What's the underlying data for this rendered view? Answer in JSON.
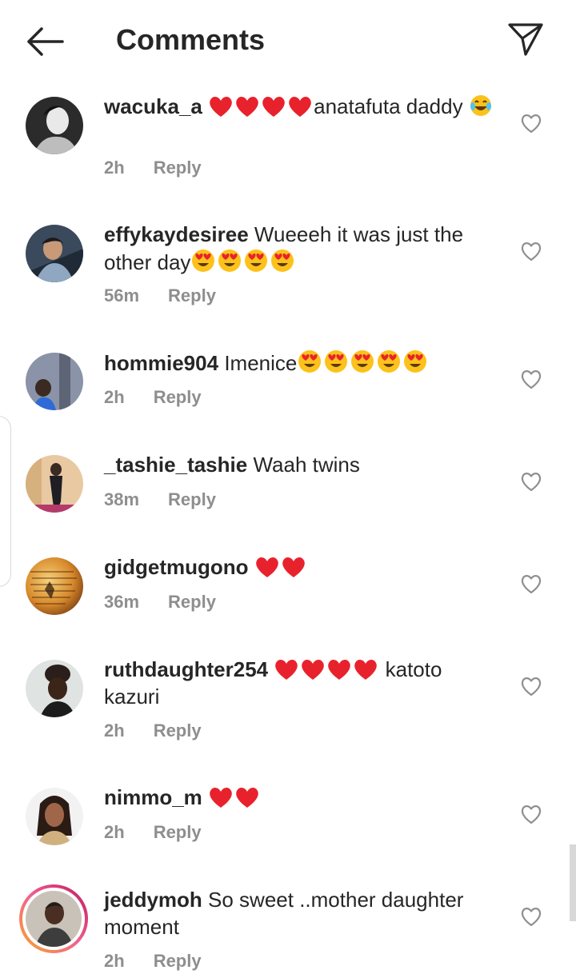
{
  "header": {
    "title": "Comments"
  },
  "comments": [
    {
      "username": "wacuka_a",
      "text": "anatafuta daddy",
      "time": "2h",
      "reply": "Reply"
    },
    {
      "username": "effykaydesiree",
      "text": "Wueeeh it was just the other day",
      "time": "56m",
      "reply": "Reply"
    },
    {
      "username": "hommie904",
      "text": "Imenice",
      "time": "2h",
      "reply": "Reply"
    },
    {
      "username": "_tashie_tashie",
      "text": "Waah twins",
      "time": "38m",
      "reply": "Reply"
    },
    {
      "username": "gidgetmugono",
      "text": "",
      "time": "36m",
      "reply": "Reply"
    },
    {
      "username": "ruthdaughter254",
      "text": " katoto kazuri",
      "time": "2h",
      "reply": "Reply"
    },
    {
      "username": "nimmo_m",
      "text": "",
      "time": "2h",
      "reply": "Reply"
    },
    {
      "username": "jeddymoh",
      "text": "So sweet ..mother daughter moment",
      "time": "2h",
      "reply": "Reply"
    }
  ],
  "icons": {
    "heart_emoji": "red-heart-icon",
    "heart_eyes_emoji": "heart-eyes-icon",
    "laugh_emoji": "tears-of-joy-icon",
    "like": "heart-outline-icon",
    "back": "arrow-left-icon",
    "send": "paper-plane-icon"
  },
  "colors": {
    "text": "#262626",
    "meta": "#8e8e8e",
    "emoji_heart": "#e8222d",
    "emoji_face": "#fcc21b",
    "story_ring": "#f06292"
  }
}
